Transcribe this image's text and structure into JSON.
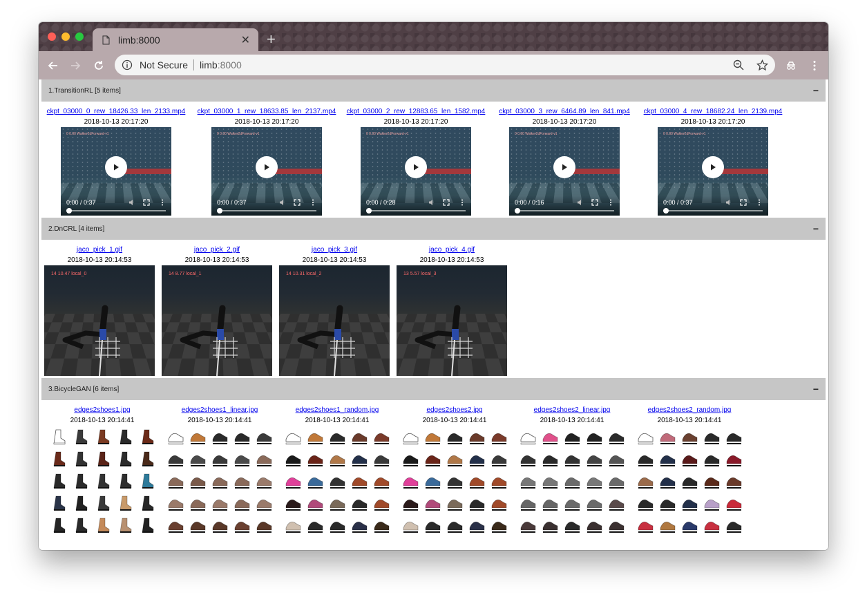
{
  "browser": {
    "tab_title": "limb:8000",
    "new_tab": "+",
    "security": "Not Secure",
    "url_host": "limb",
    "url_rest": ":8000"
  },
  "sections": [
    {
      "title": "1.TransitionRL [5 items]",
      "collapse": "−",
      "items": [
        {
          "name": "ckpt_03000_0_rew_18426.33_len_2133.mp4",
          "time": "2018-10-13 20:17:20",
          "video_label": "0  0.00  Walker2dForward-v1",
          "duration": "0:00 / 0:37"
        },
        {
          "name": "ckpt_03000_1_rew_18633.85_len_2137.mp4",
          "time": "2018-10-13 20:17:20",
          "video_label": "0  0.00  Walker2dForward-v1",
          "duration": "0:00 / 0:37"
        },
        {
          "name": "ckpt_03000_2_rew_12883.65_len_1582.mp4",
          "time": "2018-10-13 20:17:20",
          "video_label": "0  0.00  Walker2dForward-v1",
          "duration": "0:00 / 0:28"
        },
        {
          "name": "ckpt_03000_3_rew_6464.89_len_841.mp4",
          "time": "2018-10-13 20:17:20",
          "video_label": "0  0.00  Walker2dForward-v1",
          "duration": "0:00 / 0:16"
        },
        {
          "name": "ckpt_03000_4_rew_18682.24_len_2139.mp4",
          "time": "2018-10-13 20:17:20",
          "video_label": "0  0.00  Walker2dForward-v1",
          "duration": "0:00 / 0:37"
        }
      ]
    },
    {
      "title": "2.DnCRL [4 items]",
      "collapse": "−",
      "items": [
        {
          "name": "jaco_pick_1.gif",
          "time": "2018-10-13 20:14:53",
          "gif_label": "14  10.47  local_0"
        },
        {
          "name": "jaco_pick_2.gif",
          "time": "2018-10-13 20:14:53",
          "gif_label": "14  8.77  local_1"
        },
        {
          "name": "jaco_pick_3.gif",
          "time": "2018-10-13 20:14:53",
          "gif_label": "14  10.31  local_2"
        },
        {
          "name": "jaco_pick_4.gif",
          "time": "2018-10-13 20:14:53",
          "gif_label": "13  5.57  local_3"
        }
      ]
    },
    {
      "title": "3.BicycleGAN [6 items]",
      "collapse": "−",
      "items": [
        {
          "name": "edges2shoes1.jpg",
          "time": "2018-10-13 20:14:41"
        },
        {
          "name": "edges2shoes1_linear.jpg",
          "time": "2018-10-13 20:14:41"
        },
        {
          "name": "edges2shoes1_random.jpg",
          "time": "2018-10-13 20:14:41"
        },
        {
          "name": "edges2shoes2.jpg",
          "time": "2018-10-13 20:14:41"
        },
        {
          "name": "edges2shoes2_linear.jpg",
          "time": "2018-10-13 20:14:41"
        },
        {
          "name": "edges2shoes2_random.jpg",
          "time": "2018-10-13 20:14:41"
        }
      ]
    }
  ],
  "shoe_palettes": [
    [
      "#ffffff",
      "#3a3a3a",
      "#7a3a22",
      "#2a2a2a",
      "#6b2a18",
      "#6a2a1a",
      "#333",
      "#5a2418",
      "#2c2c2c",
      "#4a2a1a",
      "#2a2a2a",
      "#2b2b2b",
      "#333",
      "#2e2e2e",
      "#2d7a9a",
      "#2a3448",
      "#222",
      "#3a3a3a",
      "#c89a6a",
      "#282828",
      "#252525",
      "#2a2a2a",
      "#c48a5a",
      "#b89070",
      "#222"
    ],
    [
      "#ffffff",
      "#c07838",
      "#2a2a2a",
      "#2a2a2a",
      "#3a3a3a",
      "#3a3a3a",
      "#4a4a4a",
      "#3a3a3a",
      "#4a4a4a",
      "#8a6a5a",
      "#8a6a5a",
      "#7a5a4a",
      "#8a6a5a",
      "#8a6a5a",
      "#9a7a6a",
      "#9a7a6a",
      "#8a6a5a",
      "#9a7a6a",
      "#8a6a5a",
      "#9a7a6a",
      "#6a4030",
      "#5a3828",
      "#5a3828",
      "#6a4030",
      "#5a3828"
    ],
    [
      "#ffffff",
      "#c07838",
      "#2a2a2a",
      "#6a3a2a",
      "#7a3a2a",
      "#1a1a1a",
      "#6a2418",
      "#b07848",
      "#23304a",
      "#3a3a3a",
      "#e0409a",
      "#3a6a9a",
      "#333",
      "#a04a2a",
      "#a04a2a",
      "#2a1a1a",
      "#b04a7a",
      "#7a6a5a",
      "#2a2a2a",
      "#a04a2a",
      "#d0c0b0",
      "#2a2a2a",
      "#2a2a2a",
      "#2a3048",
      "#3a2a1a"
    ],
    [
      "#ffffff",
      "#c07838",
      "#2a2a2a",
      "#6a3a2a",
      "#7a3a2a",
      "#1a1a1a",
      "#6a2418",
      "#b07848",
      "#23304a",
      "#3a3a3a",
      "#e0409a",
      "#3a6a9a",
      "#333",
      "#a04a2a",
      "#a04a2a",
      "#2a1a1a",
      "#b04a7a",
      "#7a6a5a",
      "#2a2a2a",
      "#a04a2a",
      "#d0c0b0",
      "#2a2a2a",
      "#2a2a2a",
      "#2a3048",
      "#3a2a1a"
    ],
    [
      "#ffffff",
      "#e0508a",
      "#222",
      "#222",
      "#2a2a2a",
      "#333",
      "#2a2a2a",
      "#333",
      "#444",
      "#555",
      "#777",
      "#777",
      "#6a6a6a",
      "#777",
      "#6a6a6a",
      "#666",
      "#666",
      "#6a6a6a",
      "#6a6a6a",
      "#5a4a4a",
      "#4a3a3a",
      "#3a3030",
      "#2a2a2a",
      "#3a3030",
      "#3a3030"
    ],
    [
      "#ffffff",
      "#c06a7a",
      "#6a4030",
      "#2a2a2a",
      "#2a2a2a",
      "#2a2a2a",
      "#23304a",
      "#5a1a1a",
      "#2a2a2a",
      "#8a1a2a",
      "#9a6a4a",
      "#23304a",
      "#2a2a2a",
      "#5a2a1a",
      "#6a3a2a",
      "#2a2a2a",
      "#2a2a2a",
      "#23304a",
      "#b8a0c8",
      "#c82a3a",
      "#c83040",
      "#b07840",
      "#2a3a6a",
      "#c83040",
      "#2a2a2a"
    ]
  ]
}
